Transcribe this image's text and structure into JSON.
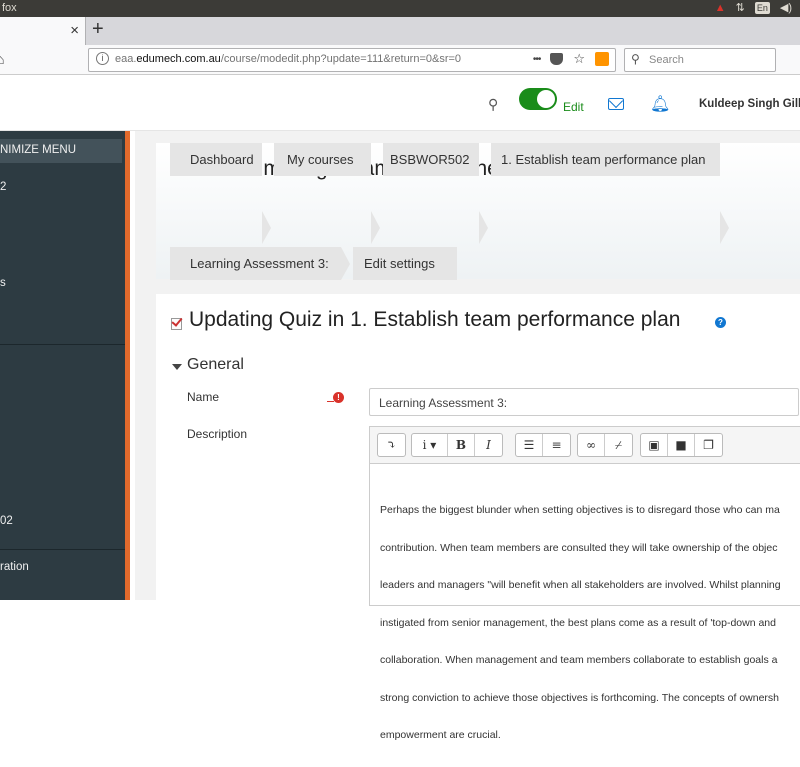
{
  "os": {
    "window_title": "fox",
    "lang": "En"
  },
  "browser": {
    "url_prefix": "eaa.",
    "url_domain": "edumech.com.au",
    "url_path": "/course/modedit.php?update=111&return=0&sr=0",
    "search_placeholder": "Search",
    "tab_close": "×",
    "new_tab": "+",
    "more_actions": "•••"
  },
  "header": {
    "edit_label": "Edit",
    "user_name": "Kuldeep Singh Gill"
  },
  "sidebar": {
    "minimize_label": "NIMIZE MENU",
    "items": [
      "2",
      "s",
      "02",
      "ration"
    ]
  },
  "page": {
    "course_title": "Lead and manage team effectiveness",
    "breadcrumbs": [
      "Dashboard",
      "My courses",
      "BSBWOR502",
      "1. Establish team performance plan",
      "Learning Assessment 3:",
      "Edit settings"
    ]
  },
  "form": {
    "title": "Updating Quiz in 1. Establish team performance plan",
    "help_glyph": "?",
    "required_glyph": "!",
    "section": "General",
    "name_label": "Name",
    "name_value": "Learning Assessment 3:",
    "description_label": "Description",
    "description_lines": [
      "Perhaps the biggest blunder when setting objectives is to disregard those who can ma",
      "contribution. When team members are consulted they will take ownership of the objec",
      "leaders and managers \"will benefit when all stakeholders are involved. Whilst planning",
      "instigated from senior management, the best plans come as a result of 'top-down and",
      "collaboration. When management and team members collaborate to establish goals a",
      "strong conviction to achieve those objectives is forthcoming. The concepts of ownersh",
      "empowerment are crucial."
    ]
  },
  "colors": {
    "accent": "#1177d1",
    "sidebar": "#2d3b42",
    "sidebar_border": "#e26a2c",
    "edit_green": "#1a8c1a"
  }
}
